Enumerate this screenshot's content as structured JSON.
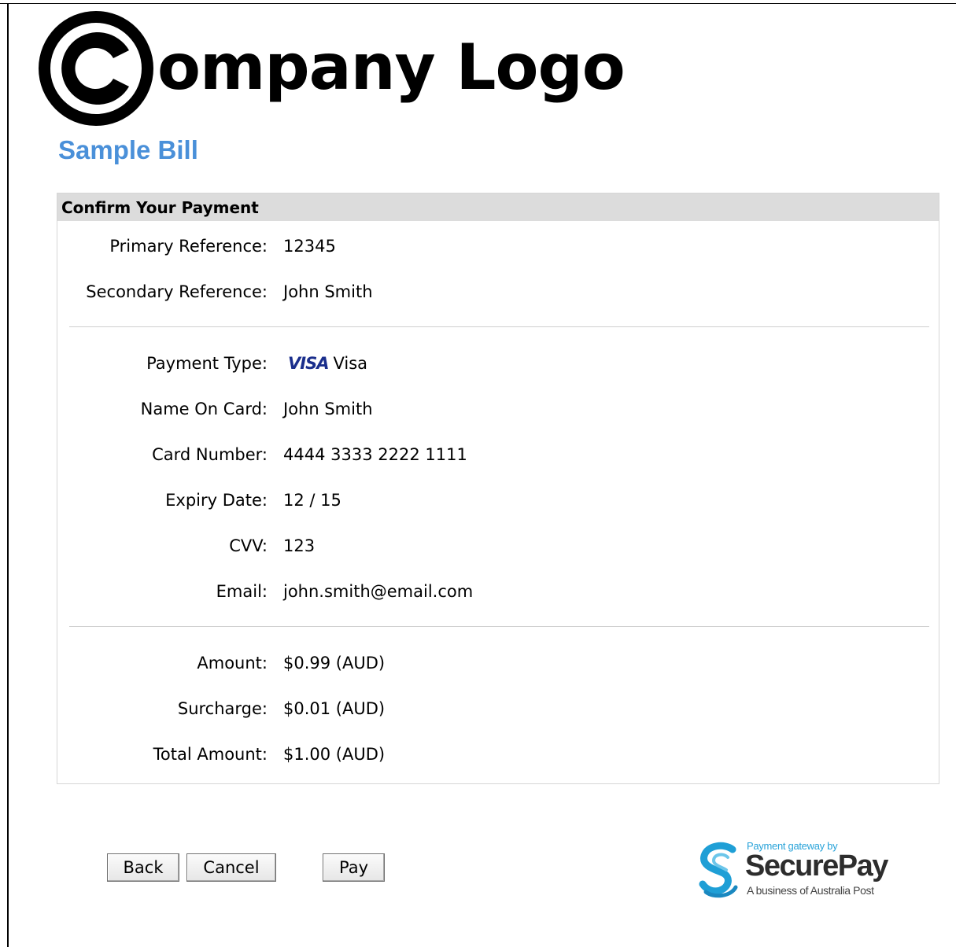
{
  "branding": {
    "logo_text": "ompany Logo",
    "logo_mark_icon": "copyright-c-icon"
  },
  "page": {
    "title": "Sample Bill"
  },
  "panel": {
    "header": "Confirm Your Payment",
    "references": [
      {
        "label": "Primary Reference:",
        "value": "12345"
      },
      {
        "label": "Secondary Reference:",
        "value": "John Smith"
      }
    ],
    "card": {
      "payment_type_label": "Payment Type:",
      "payment_type_logo": "VISA",
      "payment_type_value": "Visa",
      "name_label": "Name On Card:",
      "name_value": "John Smith",
      "number_label": "Card Number:",
      "number_value": "4444 3333 2222 1111",
      "expiry_label": "Expiry Date:",
      "expiry_value": "12 / 15",
      "cvv_label": "CVV:",
      "cvv_value": "123",
      "email_label": "Email:",
      "email_value": "john.smith@email.com"
    },
    "amounts": [
      {
        "label": "Amount:",
        "value": "$0.99 (AUD)"
      },
      {
        "label": "Surcharge:",
        "value": "$0.01 (AUD)"
      },
      {
        "label": "Total Amount:",
        "value": "$1.00 (AUD)"
      }
    ]
  },
  "buttons": {
    "back": "Back",
    "cancel": "Cancel",
    "pay": "Pay"
  },
  "securepay": {
    "tagline": "Payment gateway by",
    "name": "SecurePay",
    "subline": "A business of Australia Post",
    "icon": "securepay-s-icon"
  },
  "colors": {
    "title": "#4a90d9",
    "header_bg": "#dcdcdc",
    "visa_blue": "#1a2e8c",
    "securepay_blue": "#29a3d9"
  }
}
